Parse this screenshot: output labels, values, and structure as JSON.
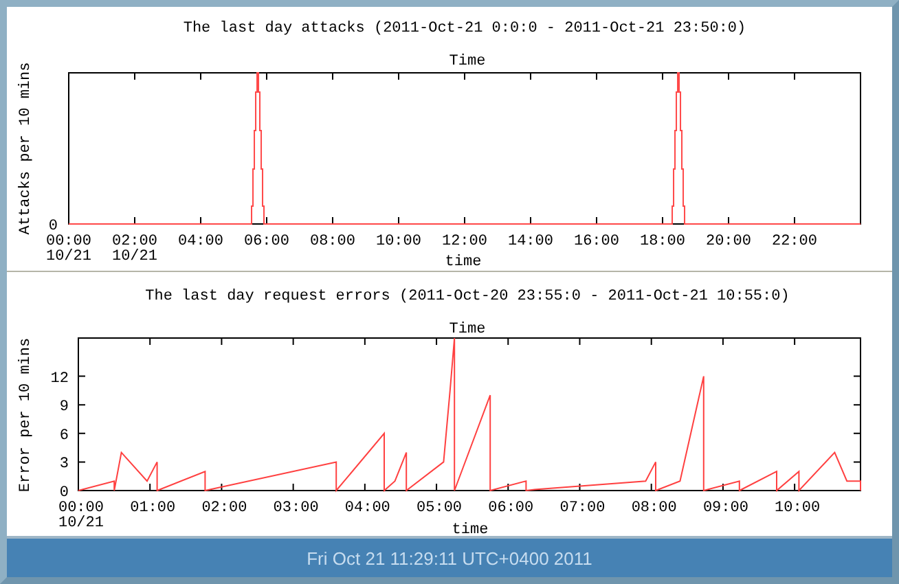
{
  "attacks_chart": {
    "title": "The last day attacks (2011-Oct-21 0:0:0 - 2011-Oct-21 23:50:0)",
    "top_label": "Time",
    "ylabel": "Attacks per 10 mins",
    "ytick_labels": [
      "0"
    ],
    "xtick_labels": [
      "00:00",
      "02:00",
      "04:00",
      "06:00",
      "08:00",
      "10:00",
      "12:00",
      "14:00",
      "16:00",
      "18:00",
      "20:00",
      "22:00"
    ],
    "date_labels": [
      "10/21",
      "10/21"
    ],
    "xlabel": "time"
  },
  "errors_chart": {
    "top_label": "Time",
    "date_labels": [
      "10/21"
    ],
    "chart_data": {
      "type": "line",
      "title": "The last day request errors (2011-Oct-20 23:55:0 - 2011-Oct-21 10:55:0)",
      "xlabel": "time",
      "ylabel": "Error per 10 mins",
      "x": [
        0,
        0.5,
        0.5,
        0.6,
        0.96,
        1.1,
        1.1,
        1.77,
        1.77,
        3.6,
        3.6,
        4.27,
        4.27,
        4.42,
        4.58,
        4.58,
        5.1,
        5.19,
        5.25,
        5.25,
        5.75,
        5.75,
        6.25,
        6.25,
        6.37,
        7.92,
        8.06,
        8.06,
        8.4,
        8.73,
        8.73,
        9.23,
        9.23,
        9.75,
        9.75,
        10.06,
        10.06,
        10.56,
        10.73,
        10.92,
        10.92
      ],
      "series": [
        {
          "color": "#ff4040",
          "values": [
            0,
            1,
            0,
            4,
            1,
            3,
            0,
            2,
            0,
            3,
            0,
            6,
            0,
            1,
            4,
            0,
            3,
            10.5,
            16,
            0,
            10,
            0,
            1,
            0,
            0.1,
            1,
            3,
            0,
            1,
            12,
            0,
            1,
            0,
            2,
            0,
            2,
            0,
            4,
            1,
            1,
            0
          ]
        }
      ],
      "xlim": [
        0,
        10.92
      ],
      "ylim": [
        0,
        16
      ],
      "xticks": [
        {
          "value": 0,
          "label": "00:00"
        },
        {
          "value": 1,
          "label": "01:00"
        },
        {
          "value": 2,
          "label": "02:00"
        },
        {
          "value": 3,
          "label": "03:00"
        },
        {
          "value": 4,
          "label": "04:00"
        },
        {
          "value": 5,
          "label": "05:00"
        },
        {
          "value": 6,
          "label": "06:00"
        },
        {
          "value": 7,
          "label": "07:00"
        },
        {
          "value": 8,
          "label": "08:00"
        },
        {
          "value": 9,
          "label": "09:00"
        },
        {
          "value": 10,
          "label": "10:00"
        }
      ],
      "yticks": [
        0,
        3,
        6,
        9,
        12
      ]
    }
  },
  "status_bar": "Fri Oct 21 11:29:11 UTC+0400 2011"
}
